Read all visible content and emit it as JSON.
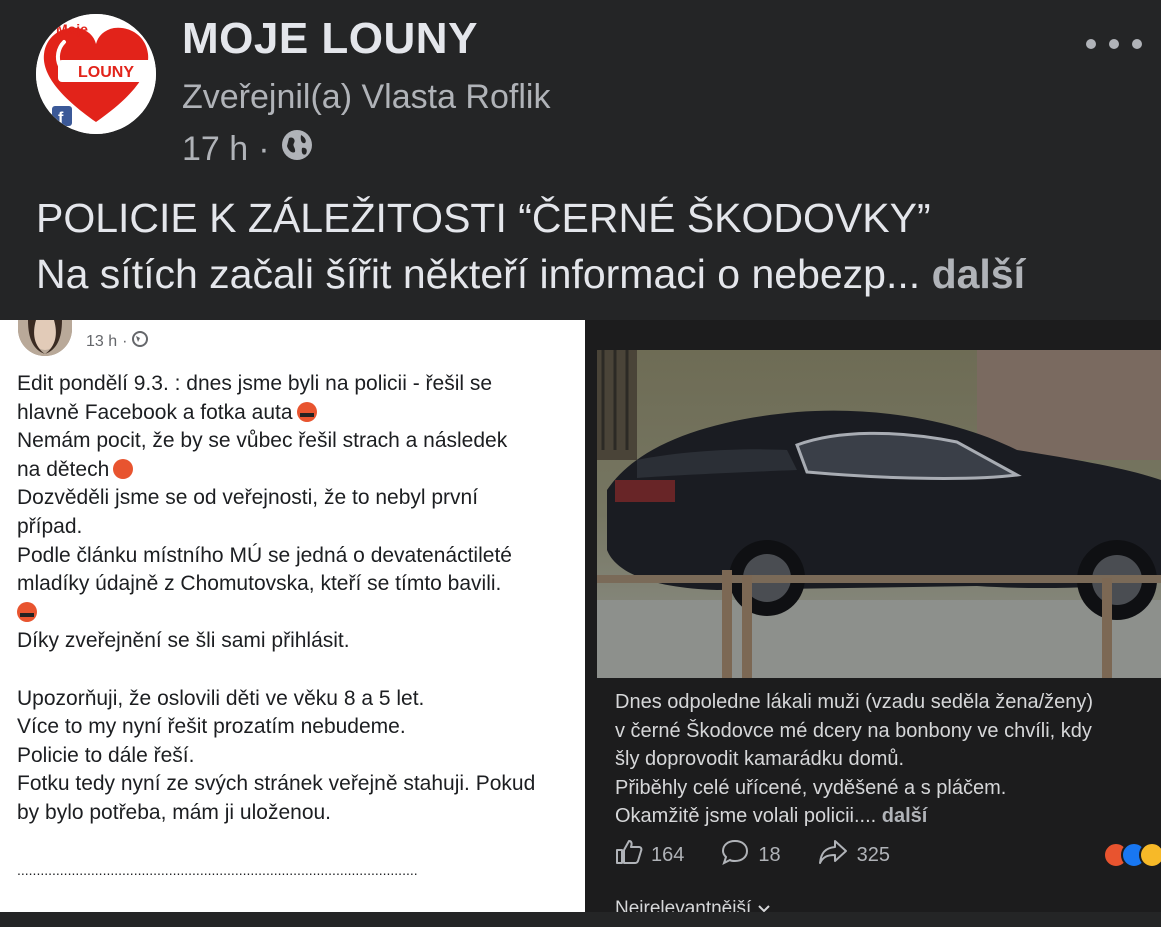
{
  "header": {
    "page_name": "MOJE LOUNY",
    "author": "Zveřejnil(a) Vlasta Roflik",
    "time": "17 h",
    "post_line1": "POLICIE K ZÁLEŽITOSTI “ČERNÉ ŠKODOVKY”",
    "post_line2": "Na sítích začali šířit někteří informaci o nebezp...",
    "more_label": "další"
  },
  "logo": {
    "top_text": "Moje",
    "main_text": "LOUNY",
    "heart_color": "#e2231a"
  },
  "left_screenshot": {
    "time": "13 h",
    "lines": [
      "Edit pondělí 9.3. : dnes jsme byli na policii - řešil se",
      "hlavně Facebook  a fotka auta",
      "Nemám pocit, že by se vůbec řešil strach a následek",
      "na dětech",
      "Dozvěděli jsme se od veřejnosti, že to nebyl první",
      "případ.",
      "Podle článku místního MÚ se jedná o devatenáctileté",
      "mladíky údajně z Chomutovska, kteří se tímto bavili.",
      "",
      "Díky zveřejnění se šli sami přihlásit.",
      "",
      "Upozorňuji, že oslovili děti ve věku 8 a 5 let.",
      "Více to my nyní řešit prozatím nebudeme.",
      "Policie to dále řeší.",
      "Fotku tedy nyní ze svých stránek veřejně stahuji. Pokud",
      "by bylo potřeba, mám ji uloženou."
    ],
    "dots": "......................................................................................................."
  },
  "right_screenshot": {
    "caption_lines": [
      "Dnes odpoledne lákali muži (vzadu seděla žena/ženy)",
      "v černé Škodovce mé dcery na bonbony ve chvíli, kdy",
      "šly doprovodit kamarádku domů.",
      "Přiběhly celé uřícené, vyděšené a s pláčem.",
      "Okamžitě jsme volali policii...."
    ],
    "more_label": "další",
    "likes": "164",
    "comments": "18",
    "shares": "325",
    "sort_label": "Nejrelevantnější"
  },
  "colors": {
    "background": "#242526",
    "text_primary": "#e4e6eb",
    "text_secondary": "#b0b3b8",
    "like_blue": "#1877f2",
    "angry_orange": "#e8542f"
  },
  "icons": [
    "globe-icon",
    "more-options-icon",
    "like-icon",
    "comment-icon",
    "share-icon",
    "chevron-down-icon"
  ]
}
